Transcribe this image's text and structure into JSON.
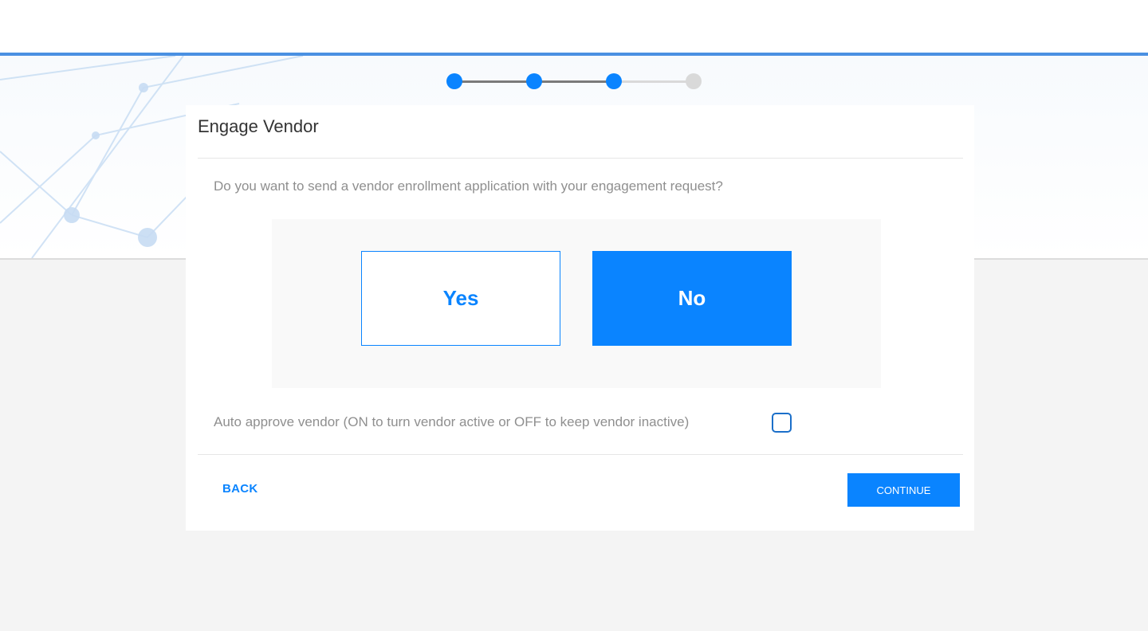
{
  "colors": {
    "accent": "#0a84ff",
    "header_border": "#4a90e2",
    "step_done_line": "#7a7a7a",
    "step_pending": "#d9d9d9"
  },
  "stepper": {
    "total_steps": 4,
    "current_step": 3
  },
  "card": {
    "title": "Engage Vendor",
    "question": "Do you want to send a vendor enrollment application with your engagement request?",
    "choices": {
      "yes_label": "Yes",
      "no_label": "No",
      "selected": "No"
    },
    "auto_approve": {
      "label": "Auto approve vendor (ON to turn vendor active or OFF to keep vendor inactive)",
      "checked": false
    },
    "footer": {
      "back_label": "BACK",
      "continue_label": "CONTINUE"
    }
  }
}
